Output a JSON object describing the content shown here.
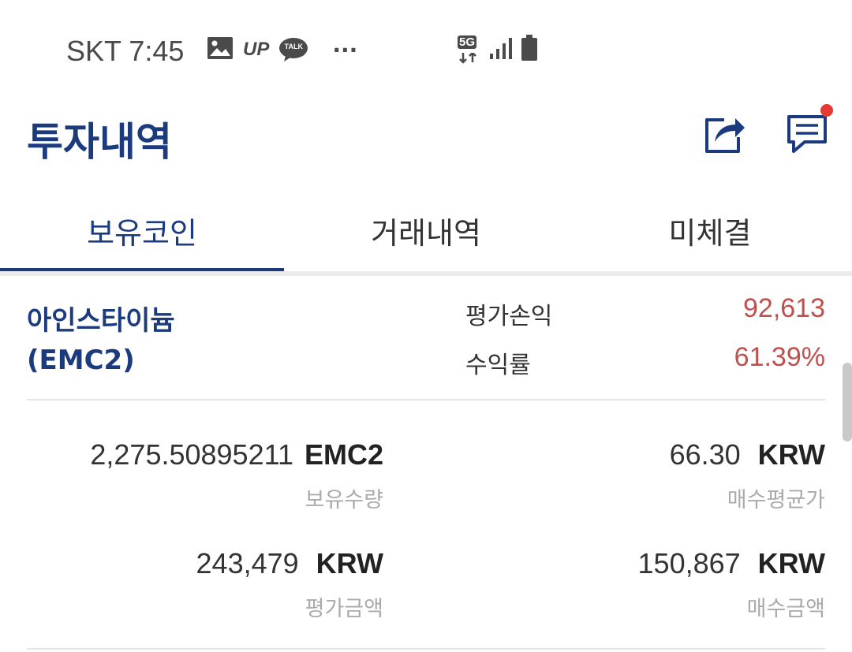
{
  "status_bar": {
    "carrier_time": "SKT 7:45",
    "up_label": "UP",
    "talk_label": "TALK",
    "more_label": "···",
    "network_label": "5G"
  },
  "header": {
    "title": "투자내역"
  },
  "tabs": [
    {
      "label": "보유코인",
      "active": true
    },
    {
      "label": "거래내역",
      "active": false
    },
    {
      "label": "미체결",
      "active": false
    }
  ],
  "coin": {
    "name": "아인스타이늄",
    "symbol": "(EMC2)",
    "eval_pl_label": "평가손익",
    "eval_pl_value": "92,613",
    "return_label": "수익률",
    "return_value": "61.39%"
  },
  "details": {
    "holding_qty": {
      "value": "2,275.50895211",
      "unit": "EMC2",
      "caption": "보유수량"
    },
    "avg_price": {
      "value": "66.30",
      "unit": "KRW",
      "caption": "매수평균가"
    },
    "eval_amount": {
      "value": "243,479",
      "unit": "KRW",
      "caption": "평가금액"
    },
    "buy_amount": {
      "value": "150,867",
      "unit": "KRW",
      "caption": "매수금액"
    }
  },
  "colors": {
    "brand": "#1b3b7e",
    "profit": "#c0504d",
    "caption": "#aaaaaa"
  }
}
